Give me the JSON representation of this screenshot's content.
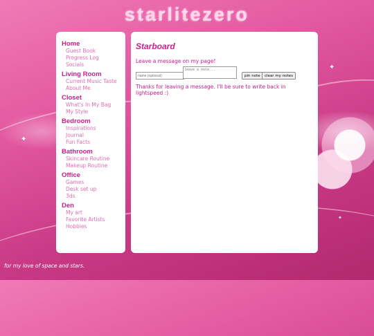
{
  "site": {
    "title": "starlitezero"
  },
  "sidebar": {
    "sections": [
      {
        "title": "Home",
        "items": [
          "Guest Book",
          "Progress Log",
          "Socials"
        ]
      },
      {
        "title": "Living Room",
        "items": [
          "Current Music Taste",
          "About Me"
        ]
      },
      {
        "title": "Closet",
        "items": [
          "What's In My Bag",
          "My Style"
        ]
      },
      {
        "title": "Bedroom",
        "items": [
          "Inspirations",
          "Journal",
          "Fun Facts"
        ]
      },
      {
        "title": "Bathroom",
        "items": [
          "Skincare Routine",
          "Makeup Routine"
        ]
      },
      {
        "title": "Office",
        "items": [
          "Games",
          "Desk set up",
          "3ds"
        ]
      },
      {
        "title": "Den",
        "items": [
          "My art",
          "Favorite Artists",
          "Hobbies"
        ]
      }
    ]
  },
  "main": {
    "title": "Starboard",
    "prompt": "Leave a message on my page!",
    "name_placeholder": "name (optional)",
    "note_placeholder": "leave a note...",
    "pin_label": "pin note",
    "clear_label": "clear my notes",
    "thanks": "Thanks for leaving a message. I'll be sure to write back in lightspeed :)"
  },
  "footer": {
    "text": "for my love of space and stars."
  },
  "colors": {
    "accent": "#d11c8c",
    "link": "#e26ab2",
    "background": "#e2569f"
  }
}
